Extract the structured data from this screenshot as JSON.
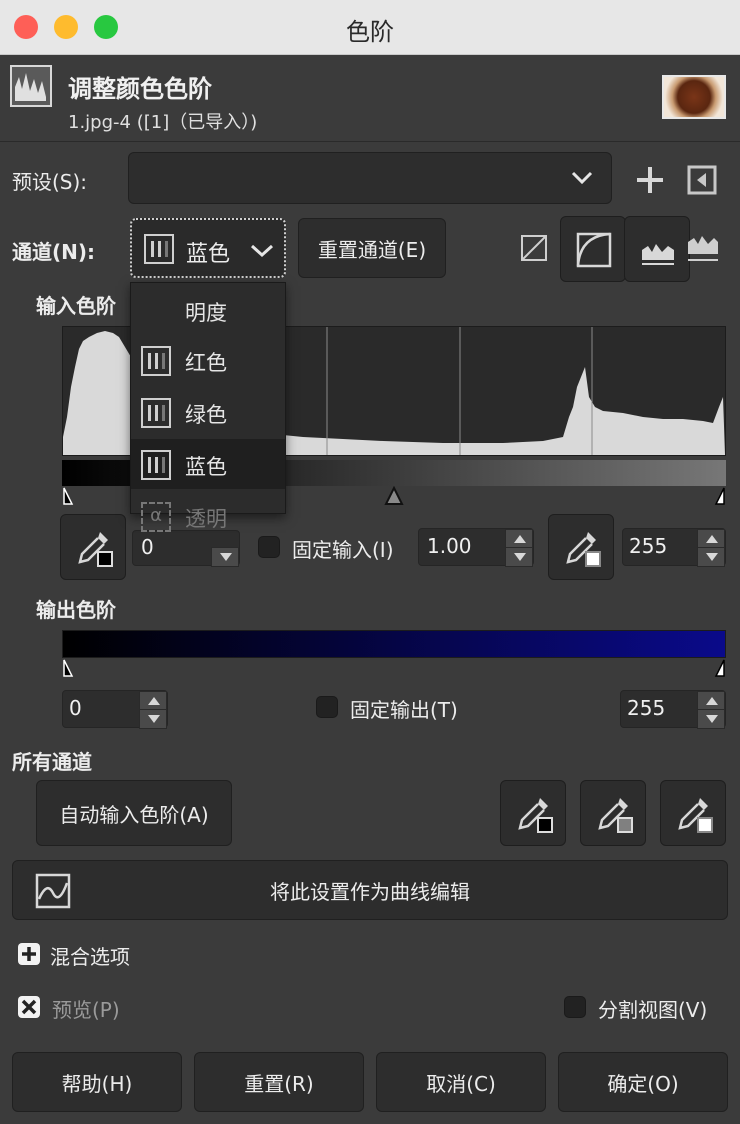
{
  "window": {
    "title": "色阶"
  },
  "header": {
    "title": "调整颜色色阶",
    "subtitle": "1.jpg-4 ([1]（已导入）)"
  },
  "presets": {
    "label": "预设(S):",
    "value": ""
  },
  "channel": {
    "label": "通道(N):",
    "selected": "蓝色",
    "reset_label": "重置通道(E)",
    "menu": [
      {
        "label": "明度",
        "selected": false,
        "enabled": true
      },
      {
        "label": "红色",
        "selected": false,
        "enabled": true
      },
      {
        "label": "绿色",
        "selected": false,
        "enabled": true
      },
      {
        "label": "蓝色",
        "selected": true,
        "enabled": true
      },
      {
        "label": "透明",
        "selected": false,
        "enabled": false
      }
    ]
  },
  "input_levels": {
    "label": "输入色阶",
    "low": "0",
    "gamma": "1.00",
    "high": "255",
    "gamma_lock_label": "固定输入(I)"
  },
  "output_levels": {
    "label": "输出色阶",
    "low": "0",
    "high": "255",
    "lock_label": "固定输出(T)"
  },
  "all_channels": {
    "label": "所有通道",
    "auto_label": "自动输入色阶(A)"
  },
  "curves_button": {
    "label": "将此设置作为曲线编辑"
  },
  "blend": {
    "label": "混合选项"
  },
  "preview": {
    "label": "预览(P)",
    "checked": true
  },
  "split": {
    "label": "分割视图(V)",
    "checked": false
  },
  "footer": {
    "help": "帮助(H)",
    "reset": "重置(R)",
    "cancel": "取消(C)",
    "ok": "确定(O)"
  },
  "colors": {
    "background": "#3b3b3b",
    "button": "#2d2d2d",
    "output_gradient_end": "#0a0a8a"
  }
}
